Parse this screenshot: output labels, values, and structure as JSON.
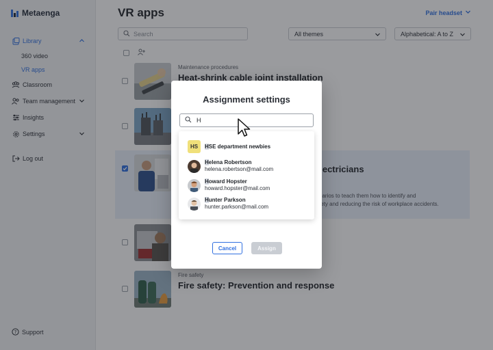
{
  "brand": {
    "name": "Metaenga"
  },
  "sidebar": {
    "library_label": "Library",
    "sub_items": [
      "360 video",
      "VR apps"
    ],
    "items": [
      "Classroom",
      "Team management",
      "Insights",
      "Settings",
      "Log out"
    ],
    "support_label": "Support"
  },
  "main": {
    "title": "VR apps",
    "pair_label": "Pair headset",
    "search_placeholder": "Search",
    "themes_filter": "All themes",
    "sort_filter": "Alphabetical: A to Z"
  },
  "rows": [
    {
      "category": "Maintenance procedures",
      "title": "Heat-shrink cable joint installation",
      "checked": false
    },
    {
      "category": "",
      "title": "",
      "checked": false
    },
    {
      "category": "",
      "title": "electricians",
      "desc": "narios to teach them how to identify and\nfety and reducing the risk of workplace accidents.",
      "checked": true
    },
    {
      "category": "",
      "title": "",
      "checked": false
    },
    {
      "category": "Fire safety",
      "title": "Fire safety: Prevention and response",
      "checked": false
    }
  ],
  "modal": {
    "title": "Assignment settings",
    "search_value": "H",
    "options": [
      {
        "initials": "HS",
        "name_highlight": "H",
        "name_rest": "SE department newbies",
        "email": ""
      },
      {
        "name_highlight": "H",
        "name_rest": "elena Robertson",
        "email": "helena.robertson@mail.com"
      },
      {
        "name_highlight": "H",
        "name_rest": "oward Hopster",
        "email": "howard.hopster@mail.com"
      },
      {
        "name_highlight": "H",
        "name_rest": "unter Parkson",
        "email": "hunter.parkson@mail.com"
      }
    ],
    "cancel_label": "Cancel",
    "assign_label": "Assign"
  },
  "colors": {
    "accent": "#2f6fe0",
    "overlay": "#1e2228",
    "group_avatar": "#f0e07a"
  }
}
